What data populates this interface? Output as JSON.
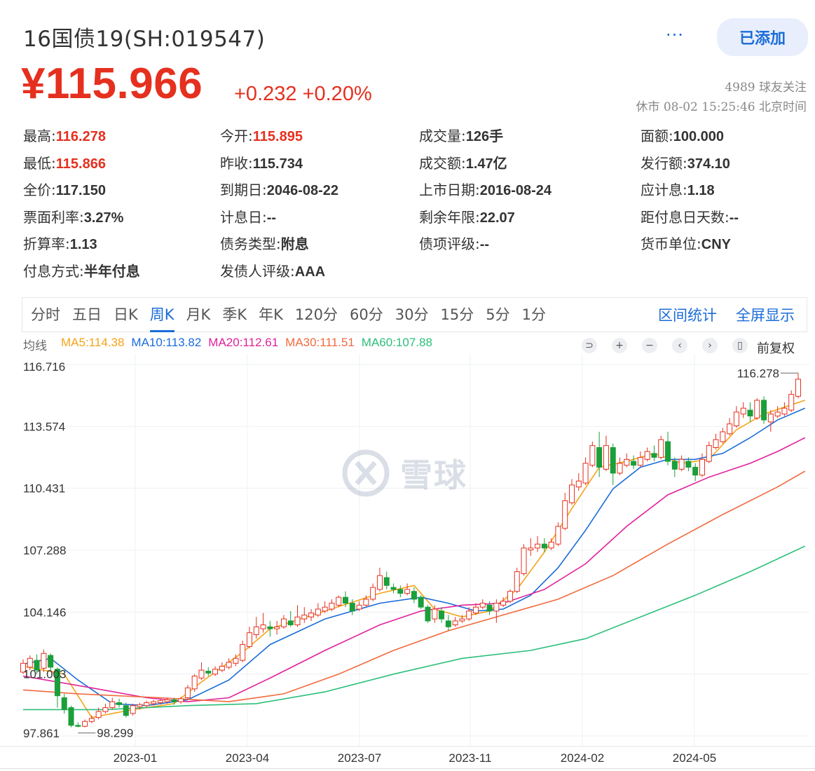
{
  "header": {
    "title": "16国债19(SH:019547)",
    "more_label": "···",
    "added_label": "已添加",
    "price": "¥115.966",
    "change": "+0.232 +0.20%",
    "followers": "4989 球友关注",
    "status": "休市 08-02 15:25:46 北京时间"
  },
  "info": [
    [
      {
        "k": "最高:",
        "v": "116.278",
        "red": true
      },
      {
        "k": "今开:",
        "v": "115.895",
        "red": true
      },
      {
        "k": "成交量:",
        "v": "126手"
      },
      {
        "k": "面额:",
        "v": "100.000"
      }
    ],
    [
      {
        "k": "最低:",
        "v": "115.866",
        "red": true
      },
      {
        "k": "昨收:",
        "v": "115.734"
      },
      {
        "k": "成交额:",
        "v": "1.47亿"
      },
      {
        "k": "发行额:",
        "v": "374.10"
      }
    ],
    [
      {
        "k": "全价:",
        "v": "117.150"
      },
      {
        "k": "到期日:",
        "v": "2046-08-22"
      },
      {
        "k": "上市日期:",
        "v": "2016-08-24"
      },
      {
        "k": "应计息:",
        "v": "1.18"
      }
    ],
    [
      {
        "k": "票面利率:",
        "v": "3.27%"
      },
      {
        "k": "计息日:",
        "v": "--"
      },
      {
        "k": "剩余年限:",
        "v": "22.07"
      },
      {
        "k": "距付息日天数:",
        "v": "--"
      }
    ],
    [
      {
        "k": "折算率:",
        "v": "1.13"
      },
      {
        "k": "债务类型:",
        "v": "附息"
      },
      {
        "k": "债项评级:",
        "v": "--"
      },
      {
        "k": "货币单位:",
        "v": "CNY"
      }
    ],
    [
      {
        "k": "付息方式:",
        "v": "半年付息"
      },
      {
        "k": "发债人评级:",
        "v": "AAA"
      }
    ]
  ],
  "tabs": [
    "分时",
    "五日",
    "日K",
    "周K",
    "月K",
    "季K",
    "年K",
    "120分",
    "60分",
    "30分",
    "15分",
    "5分",
    "1分"
  ],
  "active_tab": "周K",
  "tab_actions": {
    "range_stats": "区间统计",
    "fullscreen": "全屏显示"
  },
  "ma_bar": {
    "label": "均线",
    "items": [
      {
        "text": "MA5:114.38",
        "color": "#f5a31a"
      },
      {
        "text": "MA10:113.82",
        "color": "#1a6cd8"
      },
      {
        "text": "MA20:112.61",
        "color": "#e0229a"
      },
      {
        "text": "MA30:111.51",
        "color": "#f26a3d"
      },
      {
        "text": "MA60:107.88",
        "color": "#2cbf7a"
      }
    ]
  },
  "toolbar": {
    "adjust_label": "前复权"
  },
  "watermark": "雪球",
  "colors": {
    "up": "#e5301f",
    "down": "#1a9f3a",
    "accent": "#1a6cd8"
  },
  "chart_data": {
    "type": "candlestick",
    "y_ticks": [
      "116.716",
      "113.574",
      "110.431",
      "107.288",
      "104.146",
      "101.003",
      "97.861"
    ],
    "ylim": [
      97.861,
      116.716
    ],
    "x_ticks": [
      "2023-01",
      "2023-04",
      "2023-07",
      "2023-11",
      "2024-02",
      "2024-05"
    ],
    "annotations": {
      "max": "116.278",
      "min": "98.299"
    },
    "candles": [
      [
        101.1,
        101.55,
        101.0,
        101.75
      ],
      [
        101.35,
        101.8,
        101.2,
        101.95
      ],
      [
        101.7,
        101.2,
        101.0,
        102.0
      ],
      [
        101.3,
        102.05,
        101.1,
        102.25
      ],
      [
        101.95,
        101.35,
        101.2,
        102.05
      ],
      [
        101.25,
        99.9,
        99.3,
        101.35
      ],
      [
        99.8,
        99.2,
        99.0,
        100.0
      ],
      [
        99.3,
        98.4,
        98.3,
        99.4
      ],
      [
        98.4,
        98.35,
        98.3,
        98.55
      ],
      [
        98.35,
        98.6,
        98.3,
        98.7
      ],
      [
        98.6,
        98.75,
        98.5,
        98.9
      ],
      [
        98.8,
        99.1,
        98.7,
        99.3
      ],
      [
        99.1,
        99.3,
        99.0,
        99.5
      ],
      [
        99.3,
        99.6,
        99.2,
        99.8
      ],
      [
        99.55,
        99.45,
        99.3,
        99.75
      ],
      [
        99.4,
        98.9,
        98.8,
        99.55
      ],
      [
        99.0,
        99.4,
        98.9,
        99.5
      ],
      [
        99.35,
        99.45,
        99.2,
        99.55
      ],
      [
        99.4,
        99.55,
        99.3,
        99.65
      ],
      [
        99.5,
        99.6,
        99.4,
        99.7
      ],
      [
        99.55,
        99.65,
        99.45,
        99.75
      ],
      [
        99.6,
        99.7,
        99.5,
        99.8
      ],
      [
        99.7,
        99.6,
        99.45,
        99.8
      ],
      [
        99.6,
        99.75,
        99.5,
        99.85
      ],
      [
        99.8,
        100.3,
        99.7,
        100.45
      ],
      [
        100.25,
        100.9,
        100.1,
        101.0
      ],
      [
        100.8,
        101.2,
        100.7,
        101.6
      ],
      [
        101.15,
        101.05,
        100.9,
        101.35
      ],
      [
        101.0,
        101.25,
        100.9,
        101.4
      ],
      [
        101.2,
        101.4,
        101.1,
        101.6
      ],
      [
        101.35,
        101.6,
        101.25,
        101.8
      ],
      [
        101.55,
        101.8,
        101.4,
        102.0
      ],
      [
        101.7,
        102.5,
        101.6,
        102.7
      ],
      [
        102.4,
        103.1,
        102.3,
        103.4
      ],
      [
        103.0,
        103.4,
        102.8,
        103.9
      ],
      [
        103.3,
        103.5,
        103.1,
        104.1
      ],
      [
        103.4,
        103.3,
        102.9,
        103.7
      ],
      [
        103.3,
        103.4,
        103.0,
        103.7
      ],
      [
        103.4,
        103.8,
        103.3,
        104.0
      ],
      [
        103.7,
        103.5,
        103.4,
        104.2
      ],
      [
        103.5,
        103.9,
        103.4,
        104.5
      ],
      [
        103.8,
        104.0,
        103.6,
        104.4
      ],
      [
        103.9,
        104.1,
        103.7,
        104.3
      ],
      [
        104.0,
        104.3,
        103.9,
        104.6
      ],
      [
        104.2,
        104.4,
        104.1,
        104.7
      ],
      [
        104.3,
        104.6,
        104.2,
        104.8
      ],
      [
        104.5,
        104.9,
        104.4,
        105.0
      ],
      [
        104.9,
        104.6,
        104.4,
        105.2
      ],
      [
        104.6,
        104.2,
        104.0,
        104.8
      ],
      [
        104.3,
        104.5,
        104.2,
        104.7
      ],
      [
        104.5,
        104.8,
        104.4,
        105.0
      ],
      [
        104.8,
        105.4,
        104.7,
        105.6
      ],
      [
        105.3,
        106.0,
        105.2,
        106.4
      ],
      [
        105.9,
        105.5,
        105.3,
        106.2
      ],
      [
        105.4,
        105.3,
        105.1,
        105.6
      ],
      [
        105.3,
        105.1,
        104.9,
        105.5
      ],
      [
        105.1,
        105.3,
        105.0,
        105.6
      ],
      [
        105.2,
        104.8,
        104.6,
        105.4
      ],
      [
        104.9,
        104.4,
        104.3,
        105.0
      ],
      [
        104.4,
        103.7,
        103.6,
        104.5
      ],
      [
        103.8,
        104.3,
        103.6,
        104.5
      ],
      [
        104.2,
        103.8,
        103.6,
        104.4
      ],
      [
        103.7,
        103.4,
        103.2,
        104.0
      ],
      [
        103.5,
        103.7,
        103.4,
        103.9
      ],
      [
        103.7,
        103.8,
        103.6,
        104.0
      ],
      [
        103.8,
        104.2,
        103.7,
        104.4
      ],
      [
        104.1,
        104.4,
        104.0,
        104.6
      ],
      [
        104.4,
        104.6,
        104.3,
        104.8
      ],
      [
        104.5,
        104.2,
        104.0,
        104.7
      ],
      [
        104.2,
        104.6,
        103.6,
        104.8
      ],
      [
        104.5,
        104.7,
        104.4,
        104.9
      ],
      [
        104.7,
        105.2,
        104.6,
        105.3
      ],
      [
        105.2,
        106.2,
        105.1,
        106.4
      ],
      [
        106.1,
        107.4,
        106.0,
        107.6
      ],
      [
        107.3,
        107.4,
        107.0,
        107.9
      ],
      [
        107.4,
        107.6,
        107.2,
        108.0
      ],
      [
        107.6,
        107.4,
        107.2,
        107.9
      ],
      [
        107.4,
        107.7,
        107.3,
        107.9
      ],
      [
        107.6,
        108.5,
        107.5,
        108.7
      ],
      [
        108.4,
        109.8,
        108.3,
        110.2
      ],
      [
        109.7,
        110.6,
        109.6,
        110.9
      ],
      [
        110.5,
        110.8,
        110.3,
        111.2
      ],
      [
        110.7,
        111.7,
        110.6,
        112.0
      ],
      [
        111.6,
        112.6,
        111.5,
        112.8
      ],
      [
        112.5,
        111.5,
        111.0,
        113.3
      ],
      [
        111.4,
        112.6,
        111.3,
        113.1
      ],
      [
        112.5,
        111.2,
        110.6,
        112.7
      ],
      [
        111.2,
        111.7,
        111.1,
        112.0
      ],
      [
        111.6,
        111.9,
        111.5,
        112.2
      ],
      [
        111.8,
        111.6,
        111.4,
        112.1
      ],
      [
        111.6,
        112.0,
        111.5,
        112.3
      ],
      [
        111.9,
        112.3,
        111.8,
        112.5
      ],
      [
        112.2,
        112.0,
        111.8,
        112.6
      ],
      [
        112.0,
        112.9,
        111.9,
        113.1
      ],
      [
        112.8,
        111.8,
        111.6,
        113.3
      ],
      [
        111.8,
        111.4,
        111.0,
        112.0
      ],
      [
        111.4,
        111.9,
        111.3,
        112.1
      ],
      [
        111.8,
        111.5,
        111.3,
        112.0
      ],
      [
        111.5,
        111.1,
        110.8,
        111.7
      ],
      [
        111.1,
        111.9,
        111.0,
        112.2
      ],
      [
        111.8,
        112.6,
        111.7,
        112.8
      ],
      [
        112.5,
        112.9,
        112.4,
        113.2
      ],
      [
        112.8,
        113.3,
        112.7,
        113.5
      ],
      [
        113.2,
        113.7,
        113.1,
        114.0
      ],
      [
        113.6,
        114.3,
        113.5,
        114.6
      ],
      [
        114.2,
        114.5,
        114.0,
        114.8
      ],
      [
        114.4,
        114.1,
        113.8,
        114.8
      ],
      [
        114.0,
        114.9,
        113.9,
        115.0
      ],
      [
        114.9,
        113.9,
        113.7,
        115.1
      ],
      [
        113.8,
        114.2,
        113.3,
        114.4
      ],
      [
        114.1,
        114.3,
        114.0,
        114.6
      ],
      [
        114.2,
        114.5,
        114.1,
        114.8
      ],
      [
        114.4,
        115.2,
        114.3,
        115.4
      ],
      [
        115.1,
        115.97,
        115.0,
        116.28
      ]
    ],
    "series": [
      {
        "name": "MA5",
        "color": "#f5a31a",
        "values": [
          [
            0,
            101.4
          ],
          [
            6,
            101.0
          ],
          [
            10,
            98.8
          ],
          [
            16,
            99.2
          ],
          [
            22,
            99.5
          ],
          [
            26,
            100.6
          ],
          [
            32,
            102.1
          ],
          [
            36,
            103.3
          ],
          [
            44,
            104.2
          ],
          [
            52,
            105.1
          ],
          [
            57,
            105.5
          ],
          [
            60,
            104.3
          ],
          [
            64,
            103.9
          ],
          [
            68,
            104.2
          ],
          [
            72,
            105.3
          ],
          [
            76,
            107.2
          ],
          [
            80,
            109.4
          ],
          [
            84,
            111.5
          ],
          [
            88,
            111.8
          ],
          [
            92,
            112.2
          ],
          [
            96,
            111.7
          ],
          [
            100,
            111.9
          ],
          [
            104,
            113.4
          ],
          [
            108,
            114.2
          ],
          [
            114,
            114.9
          ]
        ]
      },
      {
        "name": "MA10",
        "color": "#1a6cd8",
        "values": [
          [
            0,
            101.5
          ],
          [
            4,
            101.8
          ],
          [
            8,
            100.7
          ],
          [
            13,
            99.5
          ],
          [
            18,
            99.4
          ],
          [
            24,
            99.7
          ],
          [
            30,
            100.7
          ],
          [
            36,
            102.5
          ],
          [
            44,
            103.8
          ],
          [
            52,
            104.6
          ],
          [
            58,
            104.9
          ],
          [
            62,
            104.6
          ],
          [
            66,
            104.2
          ],
          [
            70,
            104.3
          ],
          [
            74,
            105.0
          ],
          [
            78,
            106.4
          ],
          [
            82,
            108.3
          ],
          [
            86,
            110.4
          ],
          [
            90,
            111.5
          ],
          [
            94,
            111.9
          ],
          [
            98,
            111.9
          ],
          [
            102,
            112.2
          ],
          [
            106,
            113.0
          ],
          [
            110,
            113.9
          ],
          [
            114,
            114.5
          ]
        ]
      },
      {
        "name": "MA20",
        "color": "#e0229a",
        "values": [
          [
            0,
            100.9
          ],
          [
            10,
            100.3
          ],
          [
            18,
            99.8
          ],
          [
            24,
            99.6
          ],
          [
            30,
            99.8
          ],
          [
            36,
            100.8
          ],
          [
            44,
            102.2
          ],
          [
            52,
            103.5
          ],
          [
            58,
            104.2
          ],
          [
            64,
            104.5
          ],
          [
            70,
            104.6
          ],
          [
            76,
            105.3
          ],
          [
            82,
            106.6
          ],
          [
            88,
            108.5
          ],
          [
            94,
            110.1
          ],
          [
            100,
            111.0
          ],
          [
            106,
            111.7
          ],
          [
            110,
            112.3
          ],
          [
            114,
            113.0
          ]
        ]
      },
      {
        "name": "MA30",
        "color": "#f26a3d",
        "values": [
          [
            0,
            100.2
          ],
          [
            8,
            100.0
          ],
          [
            20,
            99.8
          ],
          [
            30,
            99.6
          ],
          [
            38,
            100.0
          ],
          [
            46,
            101.0
          ],
          [
            54,
            102.2
          ],
          [
            62,
            103.2
          ],
          [
            70,
            104.0
          ],
          [
            78,
            104.8
          ],
          [
            86,
            106.0
          ],
          [
            94,
            107.6
          ],
          [
            102,
            109.1
          ],
          [
            110,
            110.5
          ],
          [
            114,
            111.3
          ]
        ]
      },
      {
        "name": "MA60",
        "color": "#2cbf7a",
        "values": [
          [
            0,
            99.2
          ],
          [
            12,
            99.2
          ],
          [
            24,
            99.4
          ],
          [
            34,
            99.5
          ],
          [
            44,
            100.1
          ],
          [
            54,
            101.0
          ],
          [
            64,
            101.8
          ],
          [
            74,
            102.2
          ],
          [
            82,
            102.8
          ],
          [
            90,
            103.9
          ],
          [
            98,
            105.0
          ],
          [
            106,
            106.2
          ],
          [
            114,
            107.5
          ]
        ]
      }
    ]
  }
}
